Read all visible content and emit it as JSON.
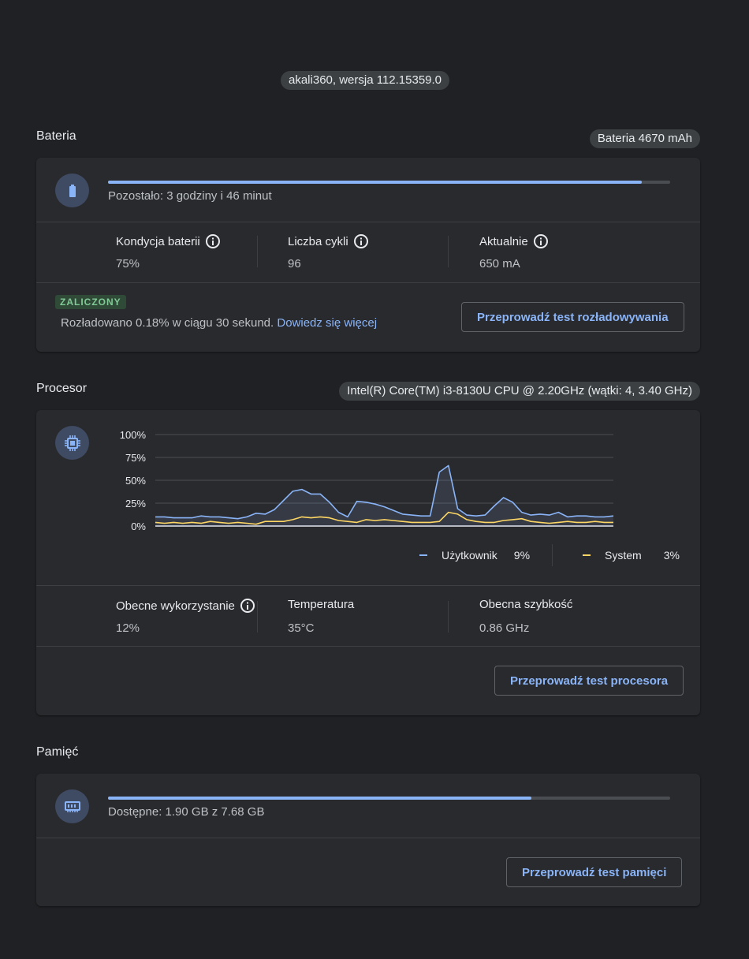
{
  "version": "akali360, wersja 112.15359.0",
  "battery": {
    "title": "Bateria",
    "capacity": "Bateria 4670 mAh",
    "icon": "battery-icon",
    "progress": 0.95,
    "remaining": "Pozostało: 3 godziny i 46 minut",
    "stats": [
      {
        "label": "Kondycja baterii",
        "value": "75%"
      },
      {
        "label": "Liczba cykli",
        "value": "96"
      },
      {
        "label": "Aktualnie",
        "value": "650 mA"
      }
    ],
    "test": {
      "badge": "ZALICZONY",
      "result": "Rozładowano 0.18% w ciągu 30 sekund.",
      "link": "Dowiedz się więcej",
      "button": "Przeprowadź test rozładowywania"
    }
  },
  "cpu": {
    "title": "Procesor",
    "model": "Intel(R) Core(TM) i3-8130U CPU @ 2.20GHz (wątki: 4, 3.40 GHz)",
    "icon": "cpu-chip-icon",
    "legend": [
      {
        "name": "Użytkownik",
        "value": "9%",
        "color": "#8ab4f8"
      },
      {
        "name": "System",
        "value": "3%",
        "color": "#fdd663"
      }
    ],
    "stats": [
      {
        "label": "Obecne wykorzystanie",
        "value": "12%"
      },
      {
        "label": "Temperatura",
        "value": "35°C"
      },
      {
        "label": "Obecna szybkość",
        "value": "0.86 GHz"
      }
    ],
    "button": "Przeprowadź test procesora"
  },
  "memory": {
    "title": "Pamięć",
    "icon": "memory-ram-icon",
    "progress": 0.753,
    "available": "Dostępne: 1.90 GB z 7.68 GB",
    "button": "Przeprowadź test pamięci"
  },
  "chart_data": {
    "type": "line",
    "ylim": [
      0,
      100
    ],
    "yticks": [
      "100%",
      "75%",
      "50%",
      "25%",
      "0%"
    ],
    "grid": true,
    "series": [
      {
        "name": "Użytkownik",
        "color": "#8ab4f8",
        "values": [
          10,
          10,
          9,
          9,
          9,
          11,
          10,
          10,
          9,
          8,
          10,
          14,
          13,
          18,
          28,
          38,
          40,
          35,
          35,
          26,
          15,
          10,
          27,
          26,
          24,
          21,
          17,
          13,
          12,
          11,
          11,
          59,
          66,
          19,
          12,
          11,
          12,
          22,
          31,
          26,
          15,
          12,
          13,
          12,
          15,
          10,
          11,
          11,
          10,
          10,
          11
        ]
      },
      {
        "name": "System",
        "color": "#fdd663",
        "values": [
          4,
          3,
          4,
          3,
          4,
          3,
          5,
          4,
          3,
          4,
          3,
          2,
          5,
          5,
          5,
          7,
          10,
          9,
          10,
          9,
          6,
          5,
          4,
          7,
          6,
          7,
          6,
          5,
          4,
          4,
          4,
          5,
          15,
          13,
          7,
          5,
          4,
          4,
          6,
          7,
          8,
          5,
          4,
          3,
          4,
          5,
          4,
          4,
          5,
          4,
          4
        ]
      }
    ]
  }
}
